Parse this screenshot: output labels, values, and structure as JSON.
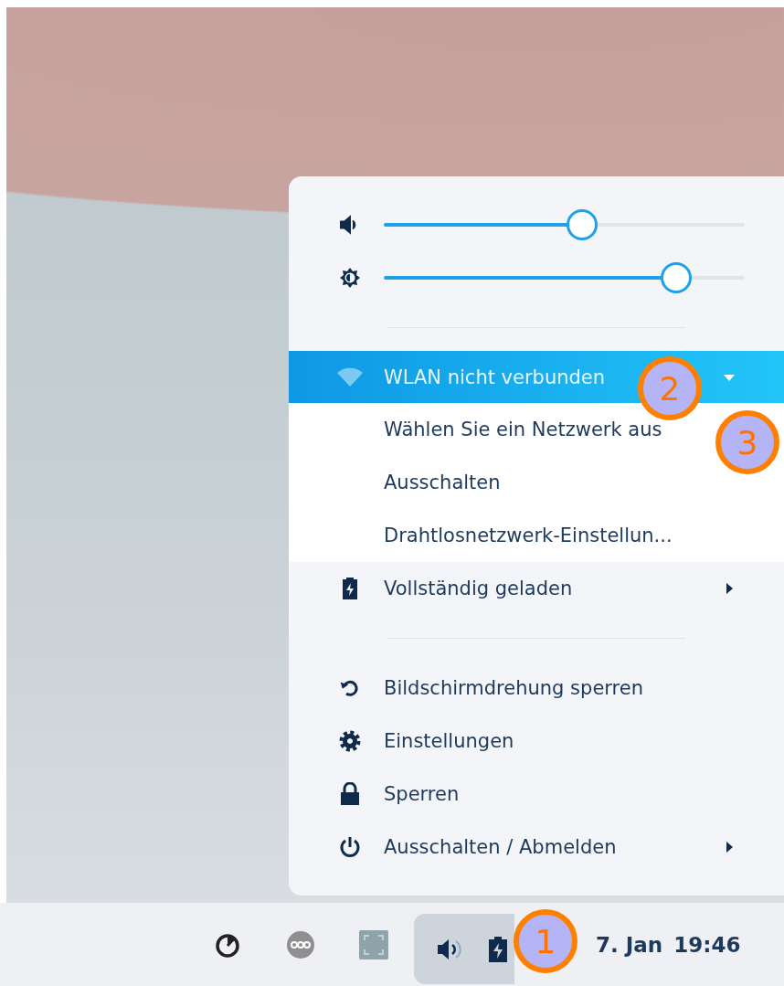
{
  "popup": {
    "sliders": [
      {
        "kind": "volume",
        "level": 0.55
      },
      {
        "kind": "brightness",
        "level": 0.81
      }
    ],
    "network": {
      "label": "WLAN nicht verbunden",
      "highlighted": true,
      "expanded": true,
      "items": [
        "Wählen Sie ein Netzwerk aus",
        "Ausschalten",
        "Drahtlosnetzwerk-Einstellun..."
      ]
    },
    "battery": {
      "label": "Vollständig geladen",
      "has_submenu": true
    },
    "actions": [
      {
        "kind": "rotate",
        "label": "Bildschirmdrehung sperren",
        "has_submenu": false
      },
      {
        "kind": "settings",
        "label": "Einstellungen",
        "has_submenu": false
      },
      {
        "kind": "lock",
        "label": "Sperren",
        "has_submenu": false
      },
      {
        "kind": "power",
        "label": "Ausschalten / Abmelden",
        "has_submenu": true
      }
    ]
  },
  "taskbar": {
    "tray": [
      {
        "kind": "timer"
      },
      {
        "kind": "link"
      },
      {
        "kind": "screen"
      }
    ],
    "status_group": {
      "highlighted": true,
      "icons": [
        {
          "kind": "volume"
        },
        {
          "kind": "battery"
        }
      ]
    },
    "date": "7. Jan",
    "time": "19:46"
  },
  "annotations": [
    {
      "label": "1"
    },
    {
      "label": "2"
    },
    {
      "label": "3"
    }
  ]
}
